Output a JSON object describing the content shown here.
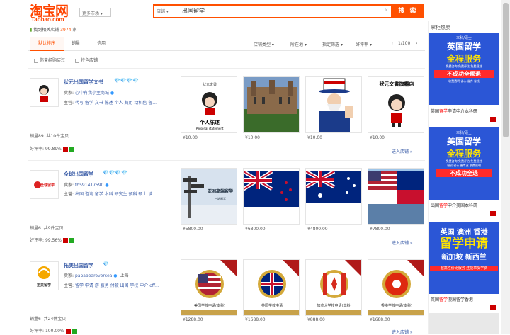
{
  "header": {
    "logo_cn": "淘宝网",
    "logo_en": "Taobao.com",
    "market": "更多市场",
    "search_type": "店铺",
    "query": "出国留学",
    "search_button": "搜 索"
  },
  "results": {
    "found_prefix": "找到相关店铺",
    "count": "3974",
    "found_suffix": "家"
  },
  "tabs": [
    "默认排序",
    "销量",
    "信用"
  ],
  "filters": [
    "店铺类型",
    "所在地",
    "指定筛选",
    "好评率"
  ],
  "pager": {
    "text": "1/100"
  },
  "checkboxes": [
    "你曾经购买过",
    "特色店铺"
  ],
  "shops": [
    {
      "name": "状元出国留学文书",
      "gems": "💎💎💎💎",
      "seller_label": "卖家:",
      "seller": "心中有我小主商城",
      "main_label": "主营:",
      "main": "代写 留学 文书 陈述 个人 费用 动机信 鲁...",
      "sales": "销量89",
      "items": "共10件宝贝",
      "rating_label": "好评率:",
      "rating": "99.89%",
      "enter": "进入店铺 »",
      "logo_text": "状元",
      "products": [
        {
          "price": "¥10.00",
          "caption": "个人陈述",
          "sub": "Personal statement",
          "brand": "狀元文書"
        },
        {
          "price": "¥10.00",
          "caption": ""
        },
        {
          "price": "¥10.00",
          "caption": ""
        },
        {
          "price": "¥10.00",
          "caption": "狀元文書旗艦店"
        }
      ]
    },
    {
      "name": "全球出国留学",
      "gems": "💎💎💎💎",
      "seller_label": "卖家:",
      "seller": "tb591417590",
      "main_label": "主营:",
      "main": "出国 咨询 留学 本科 研究生 预科 硕士 读...",
      "sales": "销量6",
      "items": "共9件宝贝",
      "rating_label": "好评率:",
      "rating": "99.56%",
      "enter": "进入店铺 »",
      "logo_text": "全球留学",
      "products": [
        {
          "price": "¥5800.00",
          "caption": "亚洲高端留学",
          "sub": "一站留学"
        },
        {
          "price": "¥6800.00",
          "caption": ""
        },
        {
          "price": "¥4800.00",
          "caption": ""
        },
        {
          "price": "¥7800.00",
          "caption": ""
        }
      ]
    },
    {
      "name": "拓美出国留学",
      "gems": "💎",
      "seller_label": "卖家:",
      "seller": "papabearoversea",
      "location": "上海",
      "main_label": "主营:",
      "main": "留学 申请 游 服务 付款 出国 学校 中介 off...",
      "sales": "销量6",
      "items": "共24件宝贝",
      "rating_label": "好评率:",
      "rating": "100.00%",
      "enter": "进入店铺 »",
      "logo_text": "拓美留学",
      "products": [
        {
          "price": "¥1288.00",
          "caption": "美国学校申请(本科)"
        },
        {
          "price": "¥1688.00",
          "caption": "英国学校申请"
        },
        {
          "price": "¥888.00",
          "caption": "加拿大学校申请(本科)"
        },
        {
          "price": "¥1688.00",
          "caption": "香港学校申请(本科)"
        }
      ]
    }
  ],
  "sidebar": {
    "title": "掌柜热卖",
    "ads": [
      {
        "lines": [
          "本科/硕士",
          "英国留学",
          "全程服务",
          "免费咨询|免费评估|免费规划",
          "不成功全额退",
          "收费透明 省心 省力 省钱"
        ],
        "cap_a": "英国",
        "cap_b": "留学",
        "cap_c": "申请",
        "cap_d": "中介本科研"
      },
      {
        "lines": [
          "本科/硕士",
          "美国留学",
          "全程服务",
          "免费咨询|免费评估|免费规划",
          "稳妥 省心 更专业 收费透明",
          "不成功全退"
        ],
        "cap_a": "出国",
        "cap_b": "留学",
        "cap_c": "中介美国本科研",
        "cap_d": ""
      },
      {
        "lines": [
          "英国 澳洲 香港",
          "留学申请",
          "新加坡 新西兰",
          "超高性价比服务 还能享受学费"
        ],
        "cap_a": "英国",
        "cap_b": "留学",
        "cap_c": "澳洲留学香港",
        "cap_d": ""
      }
    ]
  },
  "colors": {
    "accent": "#ff5000",
    "link": "#3c5ea8",
    "ad_blue": "#2b56d6"
  }
}
